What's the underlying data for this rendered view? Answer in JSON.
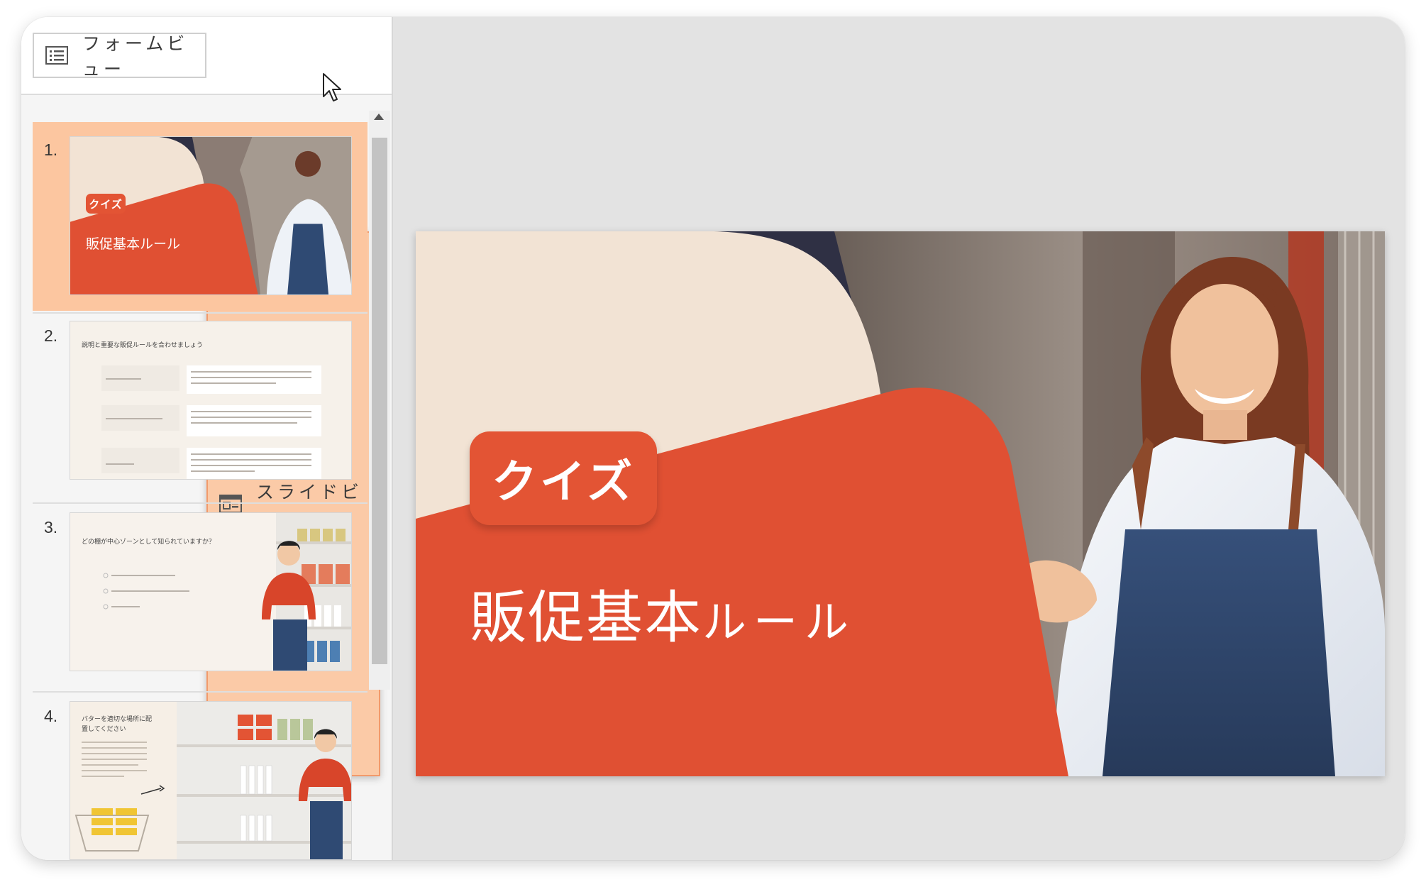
{
  "toolbar": {
    "form_view_label": "フォームビュー",
    "slide_view_label": "スライドビュー",
    "active_view": "slide"
  },
  "thumbnails": [
    {
      "number": "1.",
      "badge": "クイズ",
      "title": "販促基本ルール",
      "selected": true
    },
    {
      "number": "2.",
      "heading": "説明と重要な販促ルールを合わせましょう"
    },
    {
      "number": "3.",
      "question": "どの棚が中心ゾーンとして知られていますか？"
    },
    {
      "number": "4.",
      "heading": "バターを適切な場所に配置してください"
    }
  ],
  "slide": {
    "badge": "クイズ",
    "title_main": "販促基本",
    "title_sub": "ルール"
  },
  "colors": {
    "accent": "#e35434",
    "selected_bg": "#fcc6a0",
    "slide_beige": "#f2e3d4",
    "navy": "#2f3044"
  }
}
